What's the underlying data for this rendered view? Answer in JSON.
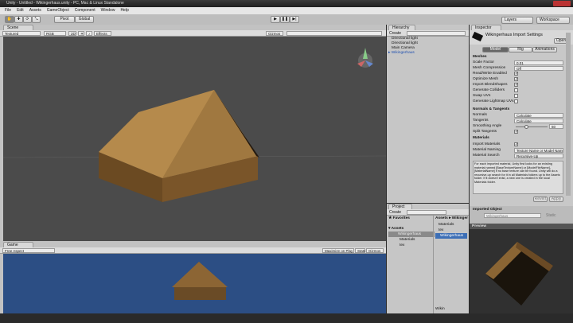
{
  "window": {
    "title": "Unity - Untitled - Wikingerhaus.unity - PC, Mac & Linux Standalone"
  },
  "menu": [
    "File",
    "Edit",
    "Assets",
    "GameObject",
    "Component",
    "Window",
    "Help"
  ],
  "toolbar": {
    "pivot": "Pivot",
    "global": "Global",
    "layers": "Layers",
    "workspace": "Workspace"
  },
  "scene": {
    "tab": "Scene",
    "render_mode": "Textured",
    "color_mode": "RGB",
    "mode_2d": "2D",
    "effects": "Effects",
    "gizmos": "Gizmos"
  },
  "game": {
    "tab": "Game",
    "aspect": "Free Aspect",
    "maximize": "Maximize on Play",
    "stats": "Stats",
    "gizmos": "Gizmos"
  },
  "hierarchy": {
    "tab": "Hierarchy",
    "create": "Create",
    "items": [
      "Directional light",
      "Directional light",
      "Main Camera",
      "Wikingerhaus"
    ]
  },
  "project": {
    "tab": "Project",
    "create": "Create",
    "favorites": "Favorites",
    "assets": "Assets",
    "breadcrumb": "Assets ▸ Wikinger",
    "tree": [
      "Wikingerhaus",
      "Materials",
      "tex"
    ],
    "files": [
      "Materials",
      "tex",
      "Wikingerhaus"
    ],
    "footer": "Wikin"
  },
  "inspector": {
    "tab": "Inspector",
    "title": "Wikingerhaus Import Settings",
    "open": "Open",
    "tabs": [
      "Model",
      "Rig",
      "Animations"
    ],
    "meshes": "Meshes",
    "fields": [
      {
        "label": "Scale Factor",
        "value": "0.01"
      },
      {
        "label": "Mesh Compression",
        "value": "Off"
      }
    ],
    "checks": [
      {
        "label": "Read/Write Enabled",
        "checked": true
      },
      {
        "label": "Optimize Mesh",
        "checked": true
      },
      {
        "label": "Import BlendShapes",
        "checked": true
      },
      {
        "label": "Generate Colliders",
        "checked": false
      },
      {
        "label": "Swap UVs",
        "checked": false
      },
      {
        "label": "Generate Lightmap UVs",
        "checked": false
      }
    ],
    "normals_header": "Normals & Tangents",
    "normals": {
      "label": "Normals",
      "value": "Calculate"
    },
    "tangents": {
      "label": "Tangents",
      "value": "Calculate"
    },
    "smoothing": {
      "label": "Smoothing Angle",
      "value": "60",
      "fraction": 0.33
    },
    "split": {
      "label": "Split Tangents",
      "checked": true
    },
    "materials_header": "Materials",
    "import_materials": {
      "label": "Import Materials",
      "checked": true
    },
    "naming": {
      "label": "Material Naming",
      "value": "Texture Name or Model Name"
    },
    "search": {
      "label": "Material Search",
      "value": "Recursive-Up"
    },
    "help": "For each imported material, Unity first looks for an existing material named [BaseTextureName] or [ModelFileName]-[MaterialName] if no base texture can be found. Unity will do a recursive-up search for it in all Materials folders up to the Assets folder. If it doesn't exist, a new one is created in the local Materials folder.",
    "revert": "Revert",
    "apply": "Apply",
    "imported_object": "Imported Object",
    "object_name": "Wikingerhaus",
    "static": "Static",
    "preview": "Preview"
  },
  "colors": {
    "scene_bg": "#4b4b4b",
    "game_bg": "#2c4e84",
    "selection": "#3d6fb6"
  }
}
